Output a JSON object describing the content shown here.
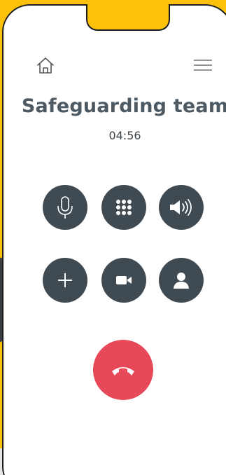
{
  "call": {
    "contact_name": "Safeguarding team",
    "duration": "04:56"
  },
  "header": {
    "home_icon": "home-icon",
    "menu_icon": "hamburger-menu-icon"
  },
  "controls": {
    "row1": [
      {
        "id": "mute",
        "icon": "microphone-icon"
      },
      {
        "id": "keypad",
        "icon": "keypad-icon"
      },
      {
        "id": "speaker",
        "icon": "speaker-icon"
      }
    ],
    "row2": [
      {
        "id": "add-call",
        "icon": "plus-icon"
      },
      {
        "id": "video",
        "icon": "video-camera-icon"
      },
      {
        "id": "contacts",
        "icon": "person-icon"
      }
    ],
    "end_call": {
      "icon": "phone-hangup-icon"
    }
  },
  "colors": {
    "background": "#fcc209",
    "button": "#3f4a52",
    "end_call": "#e8495a",
    "title": "#4e5a63"
  }
}
